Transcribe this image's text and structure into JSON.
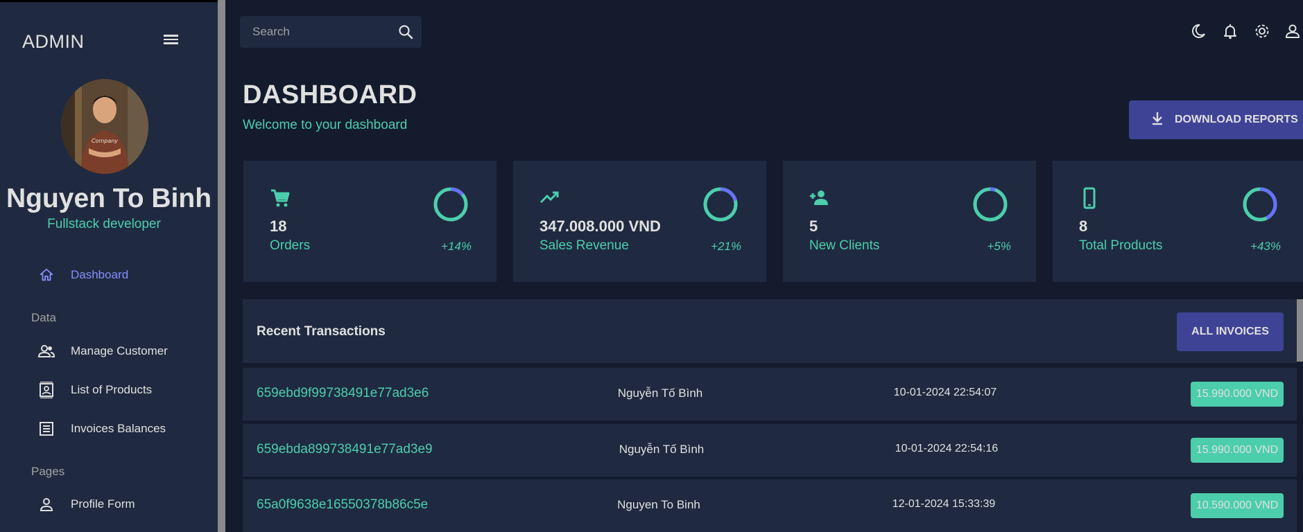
{
  "sidebar": {
    "brand": "ADMIN",
    "user_name": "Nguyen To Binh",
    "user_role": "Fullstack developer",
    "nav": [
      {
        "label": "Dashboard",
        "icon": "home-icon",
        "active": true
      },
      {
        "label": "Manage Customer",
        "icon": "people-icon",
        "active": false
      },
      {
        "label": "List of Products",
        "icon": "contacts-icon",
        "active": false
      },
      {
        "label": "Invoices Balances",
        "icon": "receipt-icon",
        "active": false
      },
      {
        "label": "Profile Form",
        "icon": "person-icon",
        "active": false
      }
    ],
    "sections": {
      "data": "Data",
      "pages": "Pages"
    }
  },
  "topbar": {
    "search_placeholder": "Search",
    "icons": [
      "dark-mode-icon",
      "notifications-icon",
      "settings-icon",
      "person-icon"
    ]
  },
  "header": {
    "title": "DASHBOARD",
    "subtitle": "Welcome to your dashboard",
    "download_label": "DOWNLOAD REPORTS"
  },
  "stats": [
    {
      "value": "18",
      "label": "Orders",
      "increase": "+14%",
      "progress": 0.14,
      "icon": "shopping-cart-icon"
    },
    {
      "value": "347.008.000 VND",
      "label": "Sales Revenue",
      "increase": "+21%",
      "progress": 0.21,
      "icon": "trending-up-icon"
    },
    {
      "value": "5",
      "label": "New Clients",
      "increase": "+5%",
      "progress": 0.05,
      "icon": "person-add-icon"
    },
    {
      "value": "8",
      "label": "Total Products",
      "increase": "+43%",
      "progress": 0.43,
      "icon": "smartphone-icon"
    }
  ],
  "transactions": {
    "title": "Recent Transactions",
    "button_label": "ALL INVOICES",
    "rows": [
      {
        "id": "659ebd9f99738491e77ad3e6",
        "user": "Nguyễn Tố Bình",
        "date": "10-01-2024 22:54:07",
        "cost": "15.990.000 VND"
      },
      {
        "id": "659ebda899738491e77ad3e9",
        "user": "Nguyễn Tố Bình",
        "date": "10-01-2024 22:54:16",
        "cost": "15.990.000 VND"
      },
      {
        "id": "65a0f9638e16550378b86c5e",
        "user": "Nguyen To Binh",
        "date": "12-01-2024 15:33:39",
        "cost": "10.590.000 VND"
      }
    ]
  },
  "colors": {
    "bg": "#141b2d",
    "panel": "#1f2a40",
    "accent_green": "#4cceac",
    "accent_blue": "#6870fa",
    "button": "#3e4396",
    "active_nav": "#868dfb"
  }
}
